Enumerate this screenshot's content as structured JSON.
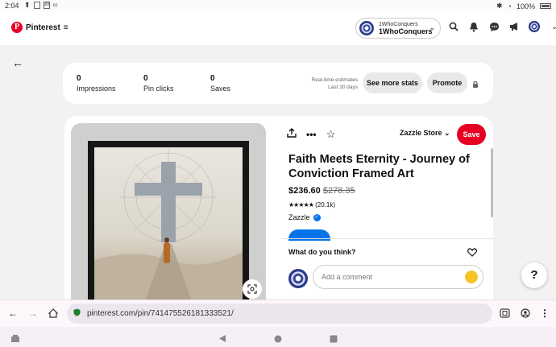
{
  "status": {
    "time": "2:04",
    "battery": "100%"
  },
  "header": {
    "brand": "Pinterest",
    "account_small": "1WhoConquers",
    "account_name": "1WhoConquers",
    "icons": [
      "search-icon",
      "bell-icon",
      "messages-icon",
      "megaphone-icon",
      "avatar",
      "chevron-down-icon"
    ]
  },
  "stats": {
    "impressions_value": "0",
    "impressions_label": "Impressions",
    "pin_clicks_value": "0",
    "pin_clicks_label": "Pin clicks",
    "saves_value": "0",
    "saves_label": "Saves",
    "estimate_line1": "Real-time estimates",
    "estimate_line2": "Last 30 days",
    "see_more": "See more stats",
    "promote": "Promote"
  },
  "pin": {
    "store": "Zazzle Store",
    "save": "Save",
    "title": "Faith Meets Eternity - Journey of Conviction Framed Art",
    "price": "$236.60",
    "old_price": "$278.35",
    "stars": "★★★★★",
    "rating_count": "(20.1k)",
    "seller": "Zazzle",
    "feedback_prompt": "What do you think?",
    "comment_placeholder": "Add a comment"
  },
  "help": "?",
  "browser": {
    "url": "pinterest.com/pin/741475526181333521/"
  },
  "colors": {
    "brand_red": "#e60023",
    "blue": "#0074e8"
  }
}
